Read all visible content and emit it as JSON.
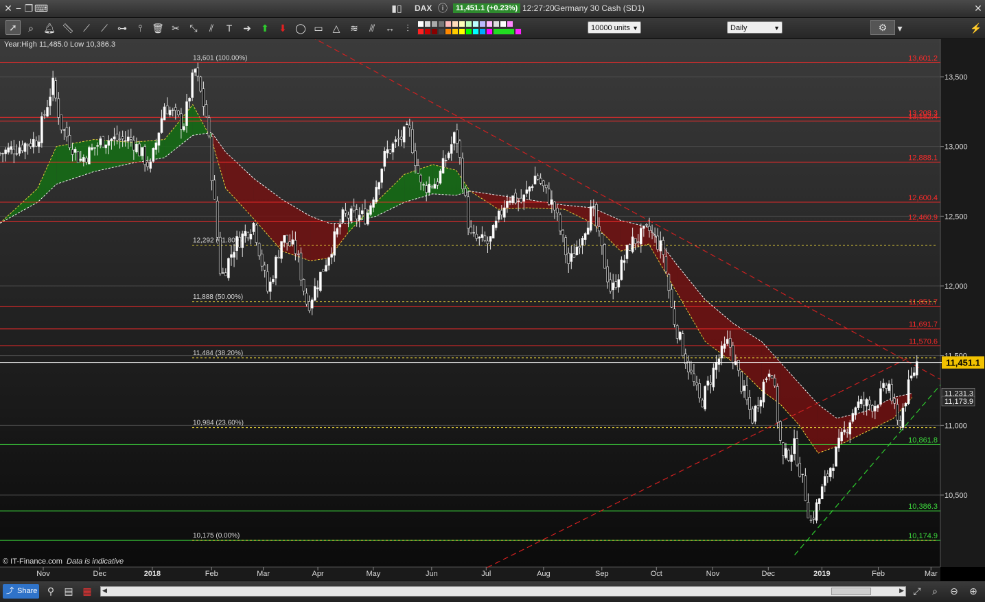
{
  "window": {
    "symbol": "DAX",
    "price_badge": "11,451.1 (+0.23%)",
    "time": "12:27:20",
    "instrument": "Germany 30 Cash (SD1)"
  },
  "toolbar": {
    "units_value": "10000 units",
    "timeframe_value": "Daily"
  },
  "statusbar": {
    "share_label": "Share"
  },
  "chart_data": {
    "type": "candlestick",
    "info_text": "Year:High 11,485.0 Low 10,386.3",
    "copyright": "© IT-Finance.com",
    "disclaimer": "Data is indicative",
    "current_price": 11451.1,
    "current_price_label": "11,451.1",
    "y_ticks": [
      {
        "v": 10500,
        "label": "10,500"
      },
      {
        "v": 11000,
        "label": "11,000"
      },
      {
        "v": 11500,
        "label": "11,500"
      },
      {
        "v": 12000,
        "label": "12,000"
      },
      {
        "v": 12500,
        "label": "12,500"
      },
      {
        "v": 13000,
        "label": "13,000"
      },
      {
        "v": 13500,
        "label": "13,500"
      }
    ],
    "x_labels": [
      {
        "label": "Nov",
        "t": 0.046,
        "bold": false
      },
      {
        "label": "Dec",
        "t": 0.106,
        "bold": false
      },
      {
        "label": "2018",
        "t": 0.162,
        "bold": true
      },
      {
        "label": "Feb",
        "t": 0.225,
        "bold": false
      },
      {
        "label": "Mar",
        "t": 0.28,
        "bold": false
      },
      {
        "label": "Apr",
        "t": 0.338,
        "bold": false
      },
      {
        "label": "May",
        "t": 0.397,
        "bold": false
      },
      {
        "label": "Jun",
        "t": 0.459,
        "bold": false
      },
      {
        "label": "Jul",
        "t": 0.517,
        "bold": false
      },
      {
        "label": "Aug",
        "t": 0.578,
        "bold": false
      },
      {
        "label": "Sep",
        "t": 0.64,
        "bold": false
      },
      {
        "label": "Oct",
        "t": 0.698,
        "bold": false
      },
      {
        "label": "Nov",
        "t": 0.758,
        "bold": false
      },
      {
        "label": "Dec",
        "t": 0.817,
        "bold": false
      },
      {
        "label": "2019",
        "t": 0.874,
        "bold": true
      },
      {
        "label": "Feb",
        "t": 0.934,
        "bold": false
      },
      {
        "label": "Mar",
        "t": 0.99,
        "bold": false
      }
    ],
    "support_resistance": [
      {
        "v": 13601.2,
        "label": "13,601.2",
        "color": "#ff2a2a"
      },
      {
        "v": 13208.3,
        "label": "13,208.3",
        "color": "#ff2a2a"
      },
      {
        "v": 13182.4,
        "label": "13,182.4",
        "color": "#ff2a2a"
      },
      {
        "v": 12888.1,
        "label": "12,888.1",
        "color": "#ff2a2a"
      },
      {
        "v": 12600.4,
        "label": "12,600.4",
        "color": "#ff2a2a"
      },
      {
        "v": 12460.9,
        "label": "12,460.9",
        "color": "#ff2a2a"
      },
      {
        "v": 11851.7,
        "label": "11,851.7",
        "color": "#ff2a2a"
      },
      {
        "v": 11691.7,
        "label": "11,691.7",
        "color": "#ff2a2a"
      },
      {
        "v": 11570.6,
        "label": "11,570.6",
        "color": "#ff2a2a"
      },
      {
        "v": 10861.8,
        "label": "10,861.8",
        "color": "#3ddc3d"
      },
      {
        "v": 10386.3,
        "label": "10,386.3",
        "color": "#3ddc3d"
      },
      {
        "v": 10174.9,
        "label": "10,174.9",
        "color": "#3ddc3d"
      }
    ],
    "fibonacci": [
      {
        "v": 13601,
        "label": "13,601 (100.00%)",
        "solid": true
      },
      {
        "v": 12292,
        "label": "12,292 (61.80%)",
        "solid": false
      },
      {
        "v": 11888,
        "label": "11,888 (50.00%)",
        "solid": false
      },
      {
        "v": 11484,
        "label": "11,484 (38.20%)",
        "solid": false
      },
      {
        "v": 10984,
        "label": "10,984 (23.60%)",
        "solid": false
      },
      {
        "v": 10175,
        "label": "10,175 (0.00%)",
        "solid": false
      }
    ],
    "right_tags": [
      {
        "v": 11231.3,
        "label": "11,231.3"
      },
      {
        "v": 11173.9,
        "label": "11,173.9"
      }
    ],
    "trendlines": [
      {
        "name": "downtrend",
        "color": "#d02020",
        "points": [
          [
            0.314,
            13850
          ],
          [
            1.0,
            11330
          ]
        ]
      },
      {
        "name": "rising-resistance",
        "color": "#d02020",
        "points": [
          [
            0.518,
            9980
          ],
          [
            0.965,
            11480
          ]
        ]
      },
      {
        "name": "rising-support",
        "color": "#2ecc2e",
        "points": [
          [
            0.845,
            10070
          ],
          [
            1.0,
            11290
          ]
        ]
      }
    ],
    "anchors": [
      {
        "t": 0.0,
        "v": 12950
      },
      {
        "t": 0.04,
        "v": 13050
      },
      {
        "t": 0.056,
        "v": 13450
      },
      {
        "t": 0.065,
        "v": 13150
      },
      {
        "t": 0.085,
        "v": 12900
      },
      {
        "t": 0.11,
        "v": 13050
      },
      {
        "t": 0.14,
        "v": 13050
      },
      {
        "t": 0.16,
        "v": 12850
      },
      {
        "t": 0.175,
        "v": 13300
      },
      {
        "t": 0.195,
        "v": 13150
      },
      {
        "t": 0.207,
        "v": 13560
      },
      {
        "t": 0.22,
        "v": 13200
      },
      {
        "t": 0.228,
        "v": 12600
      },
      {
        "t": 0.235,
        "v": 12050
      },
      {
        "t": 0.25,
        "v": 12300
      },
      {
        "t": 0.27,
        "v": 12450
      },
      {
        "t": 0.285,
        "v": 11950
      },
      {
        "t": 0.3,
        "v": 12350
      },
      {
        "t": 0.315,
        "v": 12250
      },
      {
        "t": 0.327,
        "v": 11850
      },
      {
        "t": 0.345,
        "v": 12150
      },
      {
        "t": 0.365,
        "v": 12500
      },
      {
        "t": 0.39,
        "v": 12500
      },
      {
        "t": 0.41,
        "v": 12950
      },
      {
        "t": 0.435,
        "v": 13120
      },
      {
        "t": 0.448,
        "v": 12700
      },
      {
        "t": 0.465,
        "v": 12750
      },
      {
        "t": 0.485,
        "v": 13100
      },
      {
        "t": 0.5,
        "v": 12350
      },
      {
        "t": 0.52,
        "v": 12300
      },
      {
        "t": 0.54,
        "v": 12650
      },
      {
        "t": 0.555,
        "v": 12600
      },
      {
        "t": 0.57,
        "v": 12800
      },
      {
        "t": 0.59,
        "v": 12550
      },
      {
        "t": 0.605,
        "v": 12150
      },
      {
        "t": 0.63,
        "v": 12550
      },
      {
        "t": 0.65,
        "v": 11950
      },
      {
        "t": 0.67,
        "v": 12300
      },
      {
        "t": 0.69,
        "v": 12400
      },
      {
        "t": 0.705,
        "v": 12250
      },
      {
        "t": 0.715,
        "v": 11800
      },
      {
        "t": 0.728,
        "v": 11500
      },
      {
        "t": 0.745,
        "v": 11150
      },
      {
        "t": 0.762,
        "v": 11450
      },
      {
        "t": 0.775,
        "v": 11600
      },
      {
        "t": 0.79,
        "v": 11250
      },
      {
        "t": 0.8,
        "v": 11050
      },
      {
        "t": 0.812,
        "v": 11300
      },
      {
        "t": 0.82,
        "v": 11450
      },
      {
        "t": 0.832,
        "v": 10750
      },
      {
        "t": 0.845,
        "v": 10850
      },
      {
        "t": 0.855,
        "v": 10550
      },
      {
        "t": 0.862,
        "v": 10300
      },
      {
        "t": 0.87,
        "v": 10450
      },
      {
        "t": 0.88,
        "v": 10650
      },
      {
        "t": 0.895,
        "v": 10900
      },
      {
        "t": 0.91,
        "v": 11150
      },
      {
        "t": 0.93,
        "v": 11150
      },
      {
        "t": 0.945,
        "v": 11300
      },
      {
        "t": 0.955,
        "v": 10980
      },
      {
        "t": 0.965,
        "v": 11250
      },
      {
        "t": 0.975,
        "v": 11451
      }
    ],
    "cloud": [
      {
        "t": 0.0,
        "a": 12450,
        "b": 12450
      },
      {
        "t": 0.04,
        "a": 12700,
        "b": 12600
      },
      {
        "t": 0.06,
        "a": 13000,
        "b": 12730
      },
      {
        "t": 0.1,
        "a": 13050,
        "b": 12820
      },
      {
        "t": 0.14,
        "a": 13030,
        "b": 12880
      },
      {
        "t": 0.175,
        "a": 13050,
        "b": 12920
      },
      {
        "t": 0.205,
        "a": 13300,
        "b": 13080
      },
      {
        "t": 0.225,
        "a": 13050,
        "b": 13100
      },
      {
        "t": 0.24,
        "a": 12700,
        "b": 12960
      },
      {
        "t": 0.27,
        "a": 12480,
        "b": 12770
      },
      {
        "t": 0.3,
        "a": 12250,
        "b": 12620
      },
      {
        "t": 0.33,
        "a": 12180,
        "b": 12500
      },
      {
        "t": 0.35,
        "a": 12200,
        "b": 12450
      },
      {
        "t": 0.37,
        "a": 12380,
        "b": 12450
      },
      {
        "t": 0.4,
        "a": 12600,
        "b": 12500
      },
      {
        "t": 0.43,
        "a": 12800,
        "b": 12600
      },
      {
        "t": 0.46,
        "a": 12870,
        "b": 12660
      },
      {
        "t": 0.485,
        "a": 12830,
        "b": 12650
      },
      {
        "t": 0.5,
        "a": 12680,
        "b": 12680
      },
      {
        "t": 0.53,
        "a": 12550,
        "b": 12650
      },
      {
        "t": 0.56,
        "a": 12560,
        "b": 12620
      },
      {
        "t": 0.6,
        "a": 12550,
        "b": 12580
      },
      {
        "t": 0.63,
        "a": 12450,
        "b": 12560
      },
      {
        "t": 0.66,
        "a": 12250,
        "b": 12470
      },
      {
        "t": 0.69,
        "a": 12300,
        "b": 12420
      },
      {
        "t": 0.72,
        "a": 11950,
        "b": 12150
      },
      {
        "t": 0.75,
        "a": 11600,
        "b": 11900
      },
      {
        "t": 0.78,
        "a": 11450,
        "b": 11730
      },
      {
        "t": 0.81,
        "a": 11250,
        "b": 11600
      },
      {
        "t": 0.83,
        "a": 11150,
        "b": 11450
      },
      {
        "t": 0.85,
        "a": 11000,
        "b": 11300
      },
      {
        "t": 0.87,
        "a": 10800,
        "b": 11150
      },
      {
        "t": 0.89,
        "a": 10850,
        "b": 11050
      },
      {
        "t": 0.92,
        "a": 10950,
        "b": 11100
      },
      {
        "t": 0.95,
        "a": 11050,
        "b": 11200
      },
      {
        "t": 0.97,
        "a": 11200,
        "b": 11230
      }
    ]
  }
}
